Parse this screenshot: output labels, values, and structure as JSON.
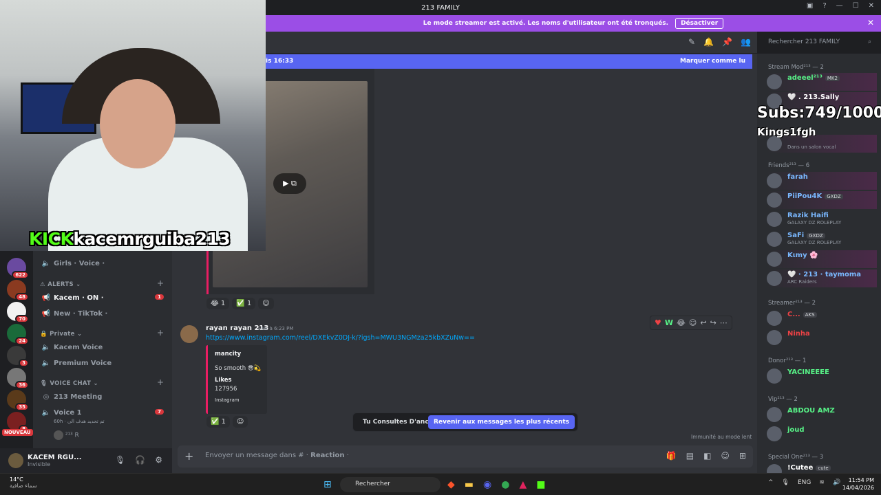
{
  "window": {
    "title": "213 FAMILY"
  },
  "banner": {
    "text": "Le mode streamer est activé. Les noms d'utilisateur ont été tronqués.",
    "button": "Désactiver"
  },
  "header": {
    "search_placeholder": "Rechercher 213 FAMILY"
  },
  "new_bar": {
    "left": "is 16:33",
    "right": "Marquer comme lu"
  },
  "servers": [
    {
      "badge": "622"
    },
    {
      "badge": "48"
    },
    {
      "badge": "70"
    },
    {
      "badge": "24"
    },
    {
      "badge": "3"
    },
    {
      "badge": "36"
    },
    {
      "badge": "35"
    },
    {
      "badge": "8"
    }
  ],
  "server_new": "NOUVEAU",
  "channels": {
    "girls_voice": "Girls · Voice ·",
    "alerts_cat": "ALERTS",
    "kacem_on": "Kacem · ON ·",
    "kacem_on_badge": "1",
    "new_tiktok": "New · TikTok ·",
    "private_cat": "Private",
    "kacem_voice": "Kacem Voice",
    "premium_voice": "Premium Voice",
    "voice_chat_cat": "VOICE CHAT",
    "meeting": "213 Meeting",
    "voice1": "Voice 1",
    "voice1_badge": "7",
    "voice1_sub": "60h · تم تحديد هدف الى",
    "voice1_user": "R"
  },
  "user_panel": {
    "name": "KACEM RGU...",
    "status": "Invisible"
  },
  "reactions1": [
    {
      "emoji": "😂",
      "count": "1"
    },
    {
      "emoji": "✅",
      "count": "1"
    }
  ],
  "message": {
    "author": "rayan rayan 213",
    "time": "Hier à 6:23 PM",
    "link": "https://www.instagram.com/reel/DXEkvZ0DJ-k/?igsh=MWU3NGMza25kbXZuNw==",
    "embed": {
      "author": "mancity",
      "desc": "So smooth 😎💫",
      "likes_label": "Likes",
      "likes": "127956",
      "footer": "Instagram"
    }
  },
  "reactions2": [
    {
      "emoji": "✅",
      "count": "1"
    }
  ],
  "jump_bar": {
    "text": "Tu Consultes D'anciens Messages",
    "button": "Revenir aux messages les plus récents"
  },
  "slow_mode": "Immunité au mode lent",
  "composer": {
    "placeholder": "Envoyer un message dans #",
    "channel": "Reaction"
  },
  "members": {
    "stream_mod": "Stream Mod²¹³ — 2",
    "friends": "Friends²¹³ — 6",
    "streamer": "Streamer²¹³ — 2",
    "donor": "Donor²¹³ — 1",
    "vip": "Vip²¹³ — 2",
    "special_one": "Special One²¹³ — 3",
    "list": [
      {
        "name": "adeeel²¹³",
        "tag": "MK2",
        "color": "#57f287",
        "sub": ""
      },
      {
        "name": "🤍 . 213.Sally",
        "tag": "",
        "color": "#ffffff",
        "sub": ""
      },
      {
        "name": "",
        "tag": "",
        "color": "#ffffff",
        "sub": "Dans un salon vocal"
      },
      {
        "name": "farah",
        "tag": "",
        "color": "#7ab8ff",
        "sub": ""
      },
      {
        "name": "PiiPou4K",
        "tag": "GXDZ",
        "color": "#7ab8ff",
        "sub": ""
      },
      {
        "name": "Razik Haifi",
        "tag": "",
        "color": "#7ab8ff",
        "sub": "GALAXY DZ ROLEPLAY"
      },
      {
        "name": "SaFi",
        "tag": "GXDZ",
        "color": "#7ab8ff",
        "sub": "GALAXY DZ ROLEPLAY"
      },
      {
        "name": "Kιmy 🌸",
        "tag": "",
        "color": "#7ab8ff",
        "sub": ""
      },
      {
        "name": "🤍 · 213 · taymoma",
        "tag": "",
        "color": "#7ab8ff",
        "sub": "ARC Raiders"
      },
      {
        "name": "C...",
        "tag": "AKS",
        "color": "#ed4245",
        "sub": ""
      },
      {
        "name": "Ninha",
        "tag": "",
        "color": "#ed4245",
        "sub": ""
      },
      {
        "name": "YACINEEEE",
        "tag": "",
        "color": "#57f287",
        "sub": ""
      },
      {
        "name": "ABDOU AMZ",
        "tag": "",
        "color": "#57f287",
        "sub": ""
      },
      {
        "name": "joud",
        "tag": "",
        "color": "#57f287",
        "sub": ""
      },
      {
        "name": "!Cutee",
        "tag": "cute",
        "color": "#ffffff",
        "sub": ""
      }
    ]
  },
  "overlay": {
    "subs": "Subs:749/1000",
    "user": "Kings1fgh",
    "kick_logo": "KICK",
    "kick_user": "kacemrguiba213"
  },
  "taskbar": {
    "temp": "14°C",
    "weather": "سماء صافية",
    "search": "Rechercher",
    "lang": "ENG",
    "time": "11:54 PM",
    "date": "14/04/2026"
  }
}
